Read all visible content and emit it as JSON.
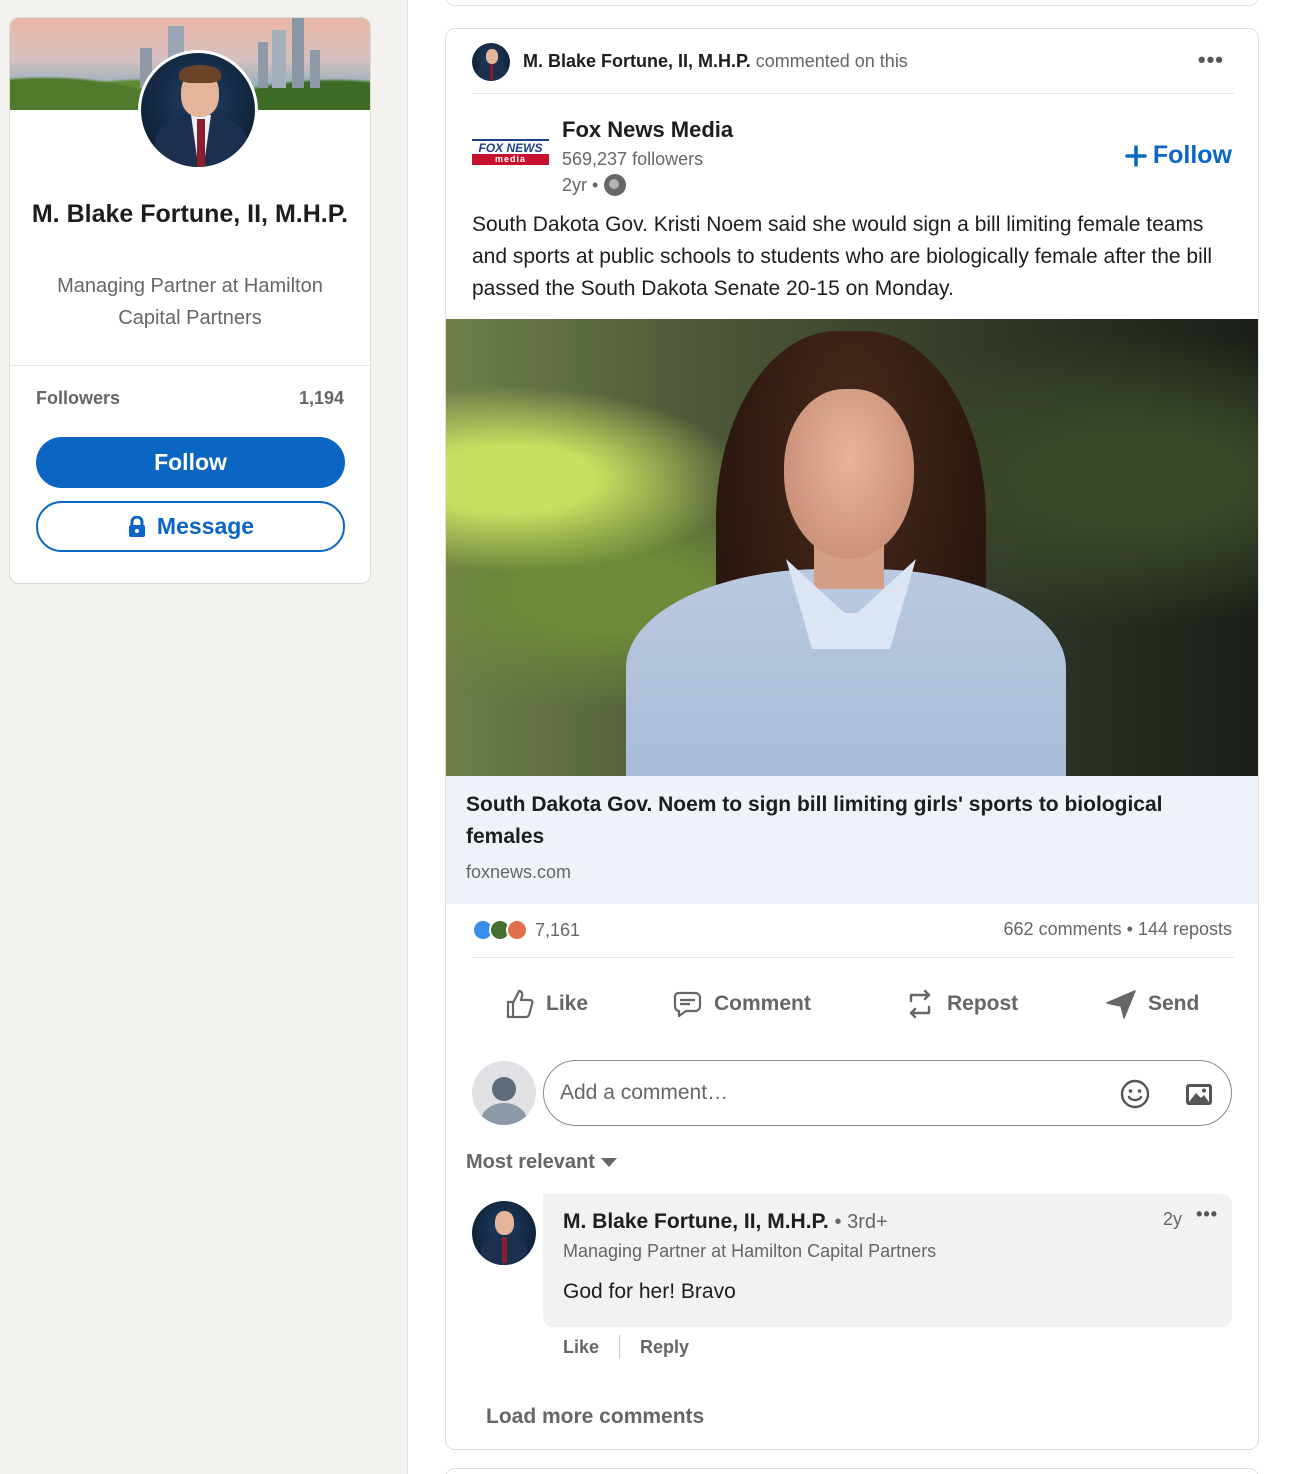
{
  "profile": {
    "name": "M. Blake Fortune, II, M.H.P.",
    "headline": "Managing Partner at Hamilton Capital Partners",
    "followers_label": "Followers",
    "followers_count": "1,194",
    "follow_label": "Follow",
    "message_label": "Message"
  },
  "post": {
    "context_actor": "M. Blake Fortune, II, M.H.P.",
    "context_action": "commented on this",
    "menu_icon": "ellipsis-icon",
    "author": {
      "name": "Fox News Media",
      "logo_top": "FOX NEWS",
      "logo_bottom": "media",
      "followers": "569,237 followers",
      "age": "2yr •",
      "visibility_icon": "globe-icon"
    },
    "follow_label": "Follow",
    "text": "South Dakota Gov. Kristi Noem said she would sign a bill limiting female teams and sports at public schools to students who are biologically female after the bill passed the South Dakota Senate 20-15 on Monday.",
    "link": {
      "title": "South Dakota Gov. Noem to sign bill limiting girls' sports to biological females",
      "source": "foxnews.com"
    },
    "social": {
      "reaction_count": "7,161",
      "comments": "662 comments",
      "separator": "•",
      "reposts": "144 reposts"
    },
    "actions": {
      "like": "Like",
      "comment": "Comment",
      "repost": "Repost",
      "send": "Send"
    },
    "comment_box": {
      "placeholder": "Add a comment…"
    },
    "sort_label": "Most relevant",
    "comments_list": [
      {
        "author": "M. Blake Fortune, II, M.H.P.",
        "degree": "• 3rd+",
        "headline": "Managing Partner at Hamilton Capital Partners",
        "text": "God for her! Bravo",
        "time": "2y",
        "like_label": "Like",
        "reply_label": "Reply"
      }
    ],
    "load_more_label": "Load more comments"
  },
  "colors": {
    "brand": "#0a66c2",
    "page_bg": "#f4f2ee",
    "muted_text": "#666666",
    "link_bg": "#edf3f8"
  }
}
